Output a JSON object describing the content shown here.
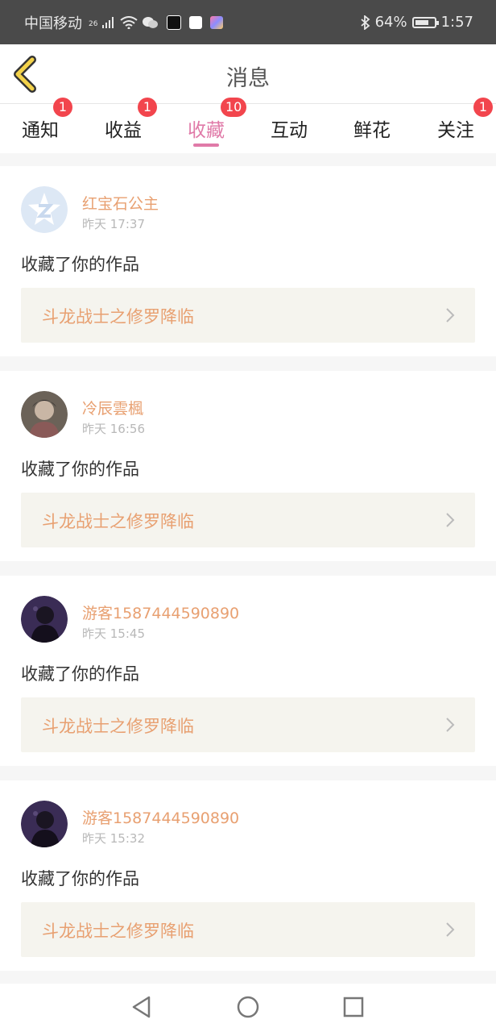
{
  "status": {
    "carrier": "中国移动",
    "network": "26",
    "battery": "64%",
    "time": "1:57"
  },
  "header": {
    "title": "消息"
  },
  "tabs": [
    {
      "label": "通知",
      "badge": "1"
    },
    {
      "label": "收益",
      "badge": "1"
    },
    {
      "label": "收藏",
      "badge": "10",
      "active": true
    },
    {
      "label": "互动",
      "badge": ""
    },
    {
      "label": "鲜花",
      "badge": ""
    },
    {
      "label": "关注",
      "badge": "1"
    }
  ],
  "messages": [
    {
      "user": "红宝石公主",
      "time": "昨天 17:37",
      "action": "收藏了你的作品",
      "work": "斗龙战士之修罗降临"
    },
    {
      "user": "冷辰雲楓",
      "time": "昨天 16:56",
      "action": "收藏了你的作品",
      "work": "斗龙战士之修罗降临"
    },
    {
      "user": "游客1587444590890",
      "time": "昨天 15:45",
      "action": "收藏了你的作品",
      "work": "斗龙战士之修罗降临"
    },
    {
      "user": "游客1587444590890",
      "time": "昨天 15:32",
      "action": "收藏了你的作品",
      "work": "斗龙战士之修罗降临"
    }
  ],
  "colors": {
    "accent_pink": "#e07aa8",
    "badge_red": "#f2454d",
    "name_orange": "#e8a071",
    "back_arrow": "#f3d24a"
  }
}
